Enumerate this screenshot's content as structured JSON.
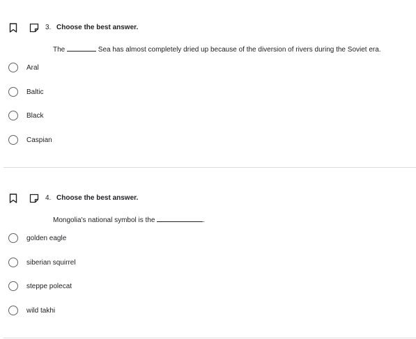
{
  "questions": [
    {
      "number": "3.",
      "title": "Choose the best answer.",
      "prompt_before": "The",
      "prompt_after": "Sea has almost completely dried up because of the diversion of rivers during the Soviet era.",
      "options": [
        "Aral",
        "Baltic",
        "Black",
        "Caspian"
      ]
    },
    {
      "number": "4.",
      "title": "Choose the best answer.",
      "prompt_before": "Mongolia's national symbol is the",
      "prompt_after": ".",
      "options": [
        "golden eagle",
        "siberian squirrel",
        "steppe polecat",
        "wild takhi"
      ]
    }
  ],
  "icons": {
    "bookmark": "bookmark-icon",
    "note": "note-icon"
  },
  "colors": {
    "text": "#202124",
    "radio_border": "#5f6368",
    "divider": "#dadce0"
  }
}
